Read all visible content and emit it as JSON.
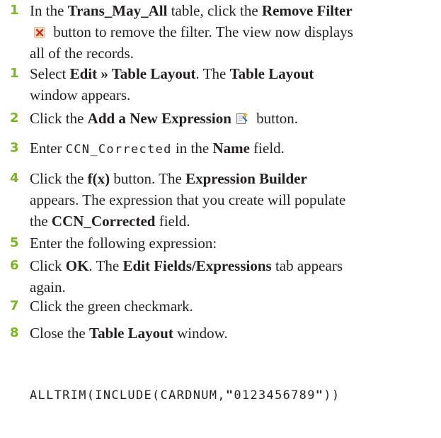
{
  "steps": [
    {
      "number": "1",
      "lines": [
        [
          "In the ",
          {
            "b": "Trans_May_All"
          },
          " table, click the ",
          {
            "b": "Remove Filter"
          }
        ],
        [
          {
            "icon": "remove-filter-icon"
          },
          " button to remove the filter. The view now displays"
        ],
        [
          "all of the records."
        ]
      ]
    },
    {
      "number": "1",
      "lines": [
        [
          "Select ",
          {
            "b": "Edit » Table Layout"
          },
          ". The ",
          {
            "b": "Table Layout"
          }
        ],
        [
          "window appears."
        ]
      ]
    },
    {
      "number": "2",
      "lines": [
        [
          "Click the ",
          {
            "b": "Add a New Expression"
          },
          {
            "icon": "add-expression-icon"
          },
          " button."
        ]
      ]
    },
    {
      "number": "3",
      "lines": [
        [
          "Enter ",
          {
            "code": "CCN_Corrected"
          },
          " in the ",
          {
            "b": "Name"
          },
          " field."
        ]
      ]
    },
    {
      "number": "4",
      "lines": [
        [
          "Click the ",
          {
            "b": "f(x)"
          },
          " button. The ",
          {
            "b": "Expression Builder"
          }
        ],
        [
          "appears. The expression that you create will populate"
        ],
        [
          "the ",
          {
            "b": "CCN_Corrected"
          },
          " field."
        ]
      ]
    },
    {
      "number": "5",
      "lines": [
        [
          "Enter the following expression:"
        ]
      ]
    },
    {
      "number": "6",
      "lines": [
        [
          "Click ",
          {
            "b": "OK"
          },
          ". The ",
          {
            "b": "Edit Fields/Expressions"
          },
          " tab appears"
        ],
        [
          "again."
        ]
      ]
    },
    {
      "number": "7",
      "lines": [
        [
          "Click the green checkmark."
        ]
      ]
    },
    {
      "number": "8",
      "lines": [
        [
          "Close the ",
          {
            "b": "Table Layout"
          },
          " window."
        ]
      ]
    }
  ],
  "expression": {
    "prefix": "ALLTRIM(INCLUDE(CARDNUM,",
    "quote_open": "\"",
    "digits": "0123456789",
    "quote_close": "\"",
    "suffix": "))"
  },
  "colors": {
    "step_number": "#7ab51d",
    "text": "#231f20"
  }
}
